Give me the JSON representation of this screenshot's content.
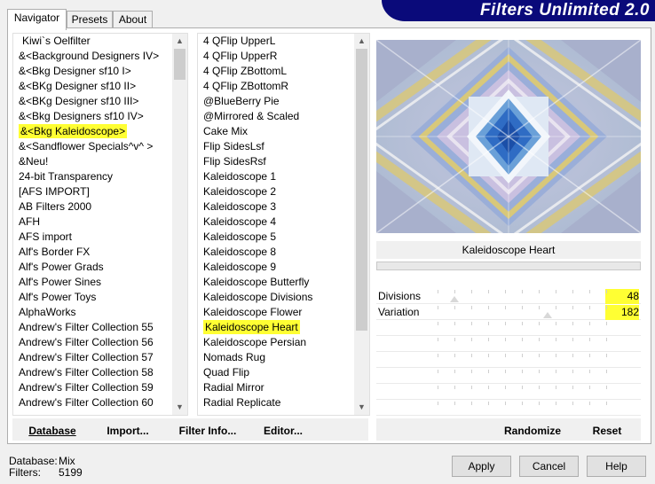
{
  "banner": {
    "title": "Filters Unlimited 2.0",
    "color": "#0a0a7a"
  },
  "tabs": [
    {
      "label": "Navigator",
      "active": true
    },
    {
      "label": "Presets",
      "active": false
    },
    {
      "label": "About",
      "active": false
    }
  ],
  "categories": [
    "Kiwi`s Oelfilter",
    "&<Background Designers IV>",
    "&<Bkg Designer sf10 I>",
    "&<BKg Designer sf10 II>",
    "&<BKg Designer sf10 III>",
    "&<Bkg Designers sf10 IV>",
    "&<Bkg Kaleidoscope>",
    "&<Sandflower Specials^v^ >",
    "&Neu!",
    "24-bit Transparency",
    "[AFS IMPORT]",
    "AB Filters 2000",
    "AFH",
    "AFS import",
    "Alf's Border FX",
    "Alf's Power Grads",
    "Alf's Power Sines",
    "Alf's Power Toys",
    "AlphaWorks",
    "Andrew's Filter Collection 55",
    "Andrew's Filter Collection 56",
    "Andrew's Filter Collection 57",
    "Andrew's Filter Collection 58",
    "Andrew's Filter Collection 59",
    "Andrew's Filter Collection 60"
  ],
  "selected_category_index": 6,
  "filters": [
    "4 QFlip UpperL",
    "4 QFlip UpperR",
    "4 QFlip ZBottomL",
    "4 QFlip ZBottomR",
    "@BlueBerry Pie",
    "@Mirrored & Scaled",
    "Cake Mix",
    "Flip SidesLsf",
    "Flip SidesRsf",
    "Kaleidoscope 1",
    "Kaleidoscope 2",
    "Kaleidoscope 3",
    "Kaleidoscope 4",
    "Kaleidoscope 5",
    "Kaleidoscope 8",
    "Kaleidoscope 9",
    "Kaleidoscope Butterfly",
    "Kaleidoscope Divisions",
    "Kaleidoscope Flower",
    "Kaleidoscope Heart",
    "Kaleidoscope Persian",
    "Nomads Rug",
    "Quad Flip",
    "Radial Mirror",
    "Radial Replicate"
  ],
  "selected_filter_index": 19,
  "preview": {
    "filter_name": "Kaleidoscope Heart"
  },
  "parameters": [
    {
      "label": "Divisions",
      "value": "48",
      "level": 0.188
    },
    {
      "label": "Variation",
      "value": "182",
      "level": 0.714
    }
  ],
  "left_buttons": {
    "database": "Database",
    "import": "Import...",
    "filter_info": "Filter Info...",
    "editor": "Editor..."
  },
  "right_buttons": {
    "randomize": "Randomize",
    "reset": "Reset"
  },
  "status": {
    "database_label": "Database:",
    "database_value": "Mix",
    "filters_label": "Filters:",
    "filters_value": "5199"
  },
  "dialog_buttons": {
    "apply": "Apply",
    "cancel": "Cancel",
    "help": "Help"
  },
  "colors": {
    "highlight": "#ffff33",
    "background": "#f0f0f0"
  }
}
